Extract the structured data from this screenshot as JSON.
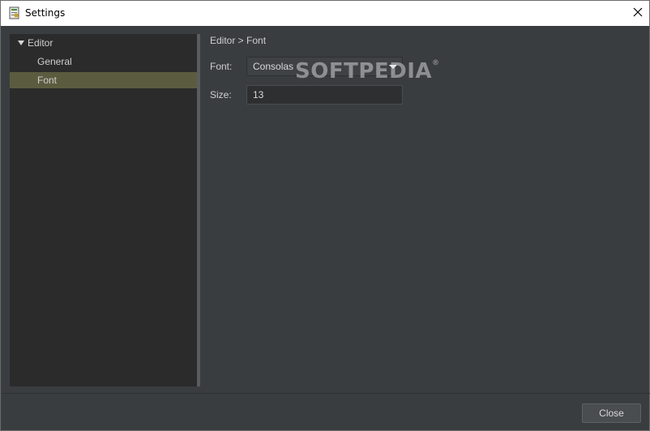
{
  "window": {
    "title": "Settings",
    "close_glyph": "✕"
  },
  "sidebar": {
    "items": [
      {
        "label": "Editor",
        "expanded": true
      },
      {
        "label": "General"
      },
      {
        "label": "Font",
        "selected": true
      }
    ]
  },
  "main": {
    "breadcrumb": "Editor > Font",
    "font_label": "Font:",
    "font_value": "Consolas",
    "size_label": "Size:",
    "size_value": "13"
  },
  "watermark": {
    "text": "SOFTPEDIA",
    "mark": "®"
  },
  "footer": {
    "close_label": "Close"
  },
  "colors": {
    "background": "#3a3d40",
    "sidebar": "#2b2b2b",
    "selection": "#5b5c3f"
  }
}
